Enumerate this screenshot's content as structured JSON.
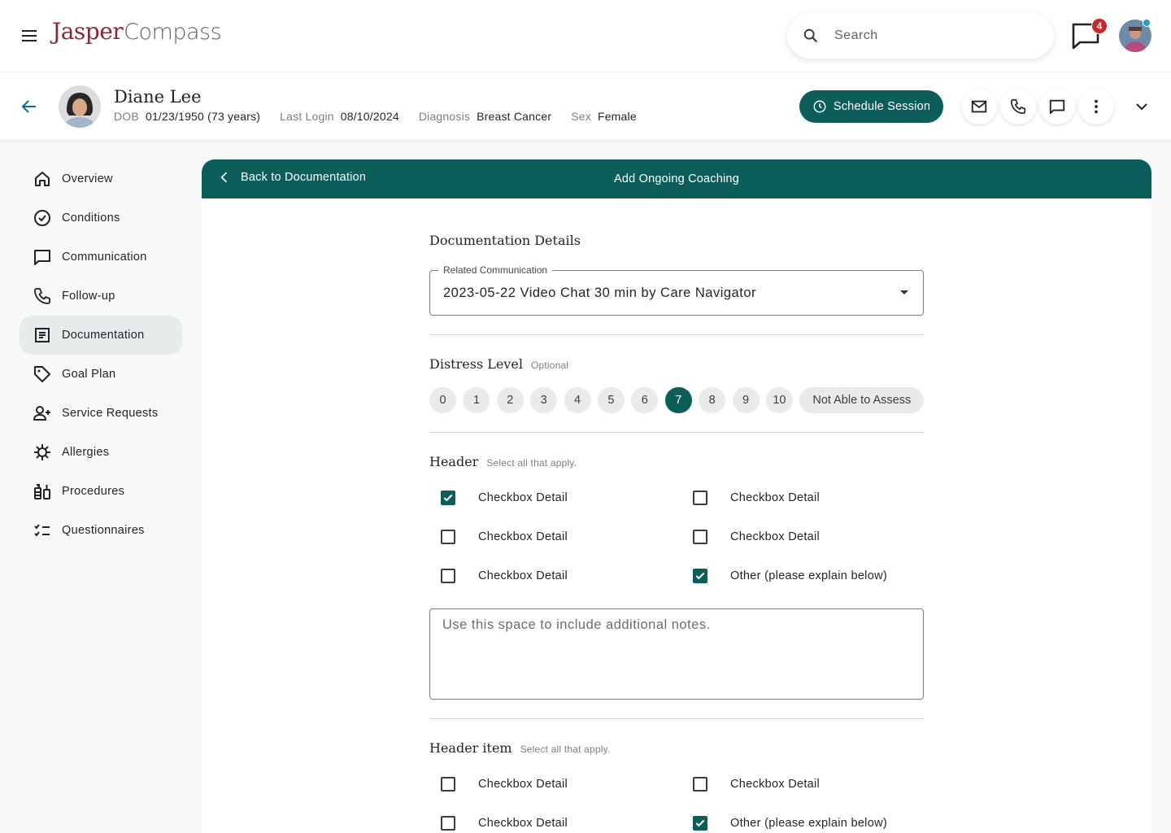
{
  "app": {
    "logo_primary": "Jasper",
    "logo_secondary": "Compass"
  },
  "topbar": {
    "search_placeholder": "Search",
    "message_badge": "4"
  },
  "patient": {
    "name": "Diane Lee",
    "dob_label": "DOB",
    "dob_value": "01/23/1950 (73 years)",
    "login_label": "Last Login",
    "login_value": "08/10/2024",
    "diagnosis_label": "Diagnosis",
    "diagnosis_value": "Breast Cancer",
    "sex_label": "Sex",
    "sex_value": "Female",
    "schedule_label": "Schedule Session"
  },
  "sidebar": {
    "items": [
      {
        "label": "Overview",
        "icon": "home-icon"
      },
      {
        "label": "Conditions",
        "icon": "check-circle-icon"
      },
      {
        "label": "Communication",
        "icon": "chat-icon"
      },
      {
        "label": "Follow-up",
        "icon": "phone-icon"
      },
      {
        "label": "Documentation",
        "icon": "document-icon",
        "active": true
      },
      {
        "label": "Goal Plan",
        "icon": "tag-icon"
      },
      {
        "label": "Service Requests",
        "icon": "person-add-icon"
      },
      {
        "label": "Allergies",
        "icon": "allergen-icon"
      },
      {
        "label": "Procedures",
        "icon": "procedures-icon"
      },
      {
        "label": "Questionnaires",
        "icon": "checklist-icon"
      }
    ]
  },
  "card": {
    "back_label": "Back to Documentation",
    "title": "Add Ongoing Coaching"
  },
  "form": {
    "details_title": "Documentation Details",
    "related_label": "Related Communication",
    "related_value": "2023-05-22 Video Chat 30 min by Care Navigator",
    "distress_title": "Distress Level",
    "distress_optional": "Optional",
    "distress_levels": [
      "0",
      "1",
      "2",
      "3",
      "4",
      "5",
      "6",
      "7",
      "8",
      "9",
      "10"
    ],
    "distress_selected": "7",
    "distress_na": "Not Able to Assess",
    "header_title": "Header",
    "header_sub": "Select all that apply.",
    "header_checks": [
      {
        "label": "Checkbox Detail",
        "checked": true
      },
      {
        "label": "Checkbox Detail",
        "checked": false
      },
      {
        "label": "Checkbox Detail",
        "checked": false
      },
      {
        "label": "Checkbox Detail",
        "checked": false
      },
      {
        "label": "Checkbox Detail",
        "checked": false
      },
      {
        "label": "Other (please explain below)",
        "checked": true
      }
    ],
    "notes_placeholder": "Use this space to include additional notes.",
    "header2_title": "Header item",
    "header2_sub": "Select all that apply.",
    "header2_checks": [
      {
        "label": "Checkbox Detail",
        "checked": false
      },
      {
        "label": "Checkbox Detail",
        "checked": false
      },
      {
        "label": "Checkbox Detail",
        "checked": false
      },
      {
        "label": "Other (please explain below)",
        "checked": true
      }
    ]
  },
  "colors": {
    "brand_teal": "#0c5e5a",
    "logo_red": "#8b2838",
    "badge_red": "#c62828"
  }
}
